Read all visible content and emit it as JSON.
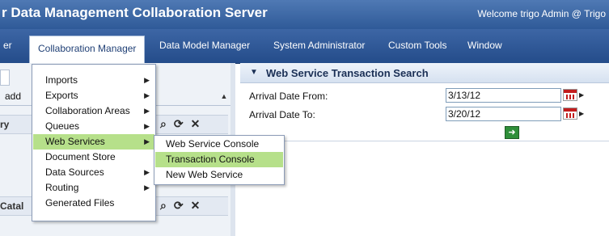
{
  "app": {
    "title": "r Data Management Collaboration Server",
    "welcome": "Welcome trigo Admin @ Trigo"
  },
  "menubar": {
    "items": [
      {
        "label": "er"
      },
      {
        "label": "Collaboration Manager"
      },
      {
        "label": "Data Model Manager"
      },
      {
        "label": "System Administrator"
      },
      {
        "label": "Custom Tools"
      },
      {
        "label": "Window"
      }
    ]
  },
  "left_panel": {
    "add_label": "add",
    "section1_label": "ry",
    "section2_label": "Catal"
  },
  "dropdown": {
    "items": [
      {
        "label": "Imports",
        "arrow": "▶"
      },
      {
        "label": "Exports",
        "arrow": "▶"
      },
      {
        "label": "Collaboration Areas",
        "arrow": "▶"
      },
      {
        "label": "Queues",
        "arrow": "▶"
      },
      {
        "label": "Web Services",
        "arrow": "▶"
      },
      {
        "label": "Document Store",
        "arrow": ""
      },
      {
        "label": "Data Sources",
        "arrow": "▶"
      },
      {
        "label": "Routing",
        "arrow": "▶"
      },
      {
        "label": "Generated Files",
        "arrow": ""
      }
    ],
    "highlighted": "Web Services"
  },
  "submenu": {
    "items": [
      {
        "label": "Web Service Console"
      },
      {
        "label": "Transaction Console"
      },
      {
        "label": "New Web Service"
      }
    ],
    "highlighted": "Transaction Console"
  },
  "search_panel": {
    "title": "Web Service Transaction Search",
    "from_label": "Arrival Date From:",
    "from_value": "3/13/12",
    "to_label": "Arrival Date To:",
    "to_value": "3/20/12"
  },
  "icons": {
    "collapse": "triangle-down-icon",
    "calendar": "calendar-icon",
    "go": "arrow-right-icon",
    "search": "search-icon",
    "refresh": "refresh-icon",
    "close": "close-icon"
  },
  "colors": {
    "menubar": "#2f5a98",
    "highlight": "#b6e08a",
    "go_button": "#2f8f3a"
  }
}
